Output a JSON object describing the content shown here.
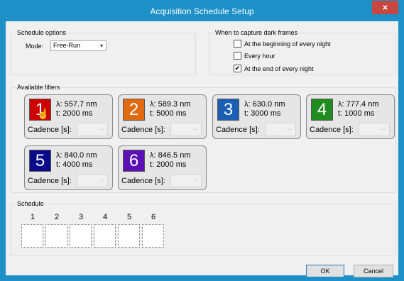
{
  "window": {
    "title": "Acquisition Schedule Setup",
    "close_glyph": "×"
  },
  "schedule_options": {
    "group_label": "Schedule options",
    "mode_label": "Mode:",
    "mode_value": "Free-Run"
  },
  "dark_frames": {
    "group_label": "When to capture dark frames",
    "options": [
      {
        "label": "At the beginning of every night",
        "checked": false
      },
      {
        "label": "Every hour",
        "checked": false
      },
      {
        "label": "At the end of every night",
        "checked": true
      }
    ]
  },
  "filters": {
    "group_label": "Available filters",
    "cadence_label": "Cadence [s]:",
    "items": [
      {
        "number": "1",
        "color": "#cc0000",
        "wavelength": "λ: 557.7 nm",
        "time": "t: 2000 ms"
      },
      {
        "number": "2",
        "color": "#e06a10",
        "wavelength": "λ: 589.3 nm",
        "time": "t: 5000 ms"
      },
      {
        "number": "3",
        "color": "#1a5fb4",
        "wavelength": "λ: 630.0 nm",
        "time": "t: 3000 ms"
      },
      {
        "number": "4",
        "color": "#1e8c1e",
        "wavelength": "λ: 777.4 nm",
        "time": "t: 1000 ms"
      },
      {
        "number": "5",
        "color": "#0a0a8a",
        "wavelength": "λ: 840.0 nm",
        "time": "t: 4000 ms"
      },
      {
        "number": "6",
        "color": "#5a10b4",
        "wavelength": "λ: 846.5 nm",
        "time": "t: 2000 ms"
      }
    ]
  },
  "schedule": {
    "group_label": "Schedule",
    "slots": [
      "1",
      "2",
      "3",
      "4",
      "5",
      "6"
    ]
  },
  "buttons": {
    "ok": "OK",
    "cancel": "Cancel"
  }
}
